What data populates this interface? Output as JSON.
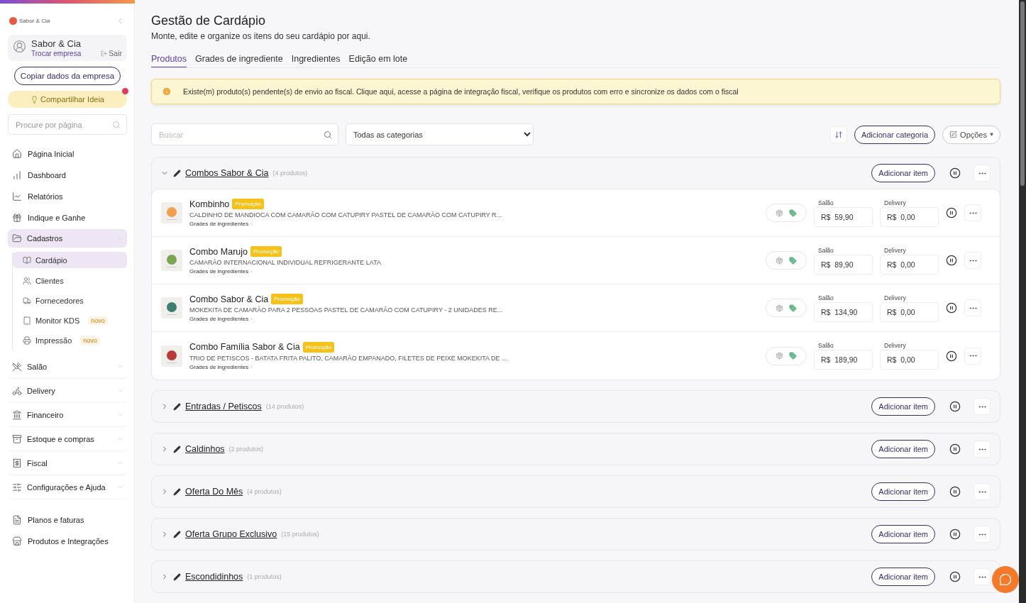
{
  "sidebar": {
    "logo_text": "Sabor & Cia",
    "company": {
      "name": "Sabor & Cia",
      "switch_label": "Trocar empresa",
      "logout_label": "Sair"
    },
    "copy_button": "Copiar dados da empresa",
    "idea_button": {
      "label": "Compartilhar Ideia",
      "notification": true
    },
    "search": {
      "placeholder": "Procure por página"
    },
    "nav": [
      {
        "kind": "link",
        "label": "Página Inicial"
      },
      {
        "kind": "link",
        "label": "Dashboard"
      },
      {
        "kind": "link",
        "label": "Relatórios"
      },
      {
        "kind": "link",
        "label": "Indique e Ganhe"
      },
      {
        "kind": "group",
        "label": "Cadastros",
        "expanded": true,
        "selected": true,
        "children": [
          {
            "label": "Cardápio",
            "selected": true
          },
          {
            "label": "Clientes",
            "selected": false
          },
          {
            "label": "Fornecedores",
            "selected": false
          },
          {
            "label": "Monitor KDS",
            "selected": false,
            "badge": "novo"
          },
          {
            "label": "Impressão",
            "selected": false,
            "badge": "novo"
          }
        ]
      },
      {
        "kind": "group",
        "label": "Salão",
        "expanded": false,
        "selected": false
      },
      {
        "kind": "group",
        "label": "Delivery",
        "expanded": false,
        "selected": false
      },
      {
        "kind": "group",
        "label": "Financeiro",
        "expanded": false,
        "selected": false
      },
      {
        "kind": "group",
        "label": "Estoque e compras",
        "expanded": false,
        "selected": false
      },
      {
        "kind": "group",
        "label": "Fiscal",
        "expanded": false,
        "selected": false
      },
      {
        "kind": "group",
        "label": "Configurações e Ajuda",
        "expanded": false,
        "selected": false
      }
    ],
    "footer_links": [
      "Planos e faturas",
      "Produtos e Integrações"
    ]
  },
  "page": {
    "title": "Gestão de Cardápio",
    "subtitle": "Monte, edite e organize os itens do seu cardápio por aqui."
  },
  "tabs": [
    {
      "label": "Produtos",
      "selected": true
    },
    {
      "label": "Grades de ingrediente",
      "selected": false
    },
    {
      "label": "Ingredientes",
      "selected": false
    },
    {
      "label": "Edição em lote",
      "selected": false
    }
  ],
  "alert": "Existe(m) produto(s) pendente(s) de envio ao fiscal. Clique aqui, acesse a página de integração fiscal, verifique os produtos com erro e sincronize os dados com o fiscal",
  "toolbar": {
    "search_placeholder": "Buscar",
    "category_filter": "Todas as categorias",
    "add_category": "Adicionar categoria",
    "options": "Opções"
  },
  "categories": [
    {
      "name": "Combos Sabor & Cia",
      "count": "(4 produtos)",
      "expanded": true,
      "add_label": "Adicionar item",
      "products": [
        {
          "name": "Kombinho",
          "badge": "Promoção",
          "description": "CALDINHO DE MANDIOCA COM CAMARÃO COM CATUPIRY PASTEL DE CAMARÃO COM CATUPIRY R...",
          "grades_link": "Grades de ingredientes",
          "color": "#f0a050",
          "salao_label": "Salão",
          "salao": "R$  59,90",
          "delivery_label": "Delivery",
          "delivery": "R$  0,00"
        },
        {
          "name": "Combo Marujo",
          "badge": "Promoção",
          "description": "CAMARÃO INTERNACIONAL INDIVIDUAL REFRIGERANTE LATA",
          "grades_link": "Grades de ingredientes",
          "color": "#7aa555",
          "salao_label": "Salão",
          "salao": "R$  89,90",
          "delivery_label": "Delivery",
          "delivery": "R$  0,00"
        },
        {
          "name": "Combo Sabor & Cia",
          "badge": "Promoção",
          "description": "MOKEKITA DE CAMARÃO PARA 2 PESSOAS PASTEL DE CAMARÃO COM CATUPIRY - 2 UNIDADES RE...",
          "grades_link": "Grades de ingredientes",
          "color": "#3f7f72",
          "salao_label": "Salão",
          "salao": "R$  134,90",
          "delivery_label": "Delivery",
          "delivery": "R$  0,00"
        },
        {
          "name": "Combo Família Sabor & Cia",
          "badge": "Promoção",
          "description": "TRIO DE PETISCOS - BATATA FRITA PALITO, CAMARÃO EMPANADO, FILETES DE PEIXE MOKEKITA DE ...",
          "grades_link": "Grades de ingredientes",
          "color": "#b83a3a",
          "salao_label": "Salão",
          "salao": "R$  189,90",
          "delivery_label": "Delivery",
          "delivery": "R$  0,00"
        }
      ]
    },
    {
      "name": "Entradas / Petiscos",
      "count": "(14 produtos)",
      "expanded": false,
      "add_label": "Adicionar item"
    },
    {
      "name": "Caldinhos",
      "count": "(2 produtos)",
      "expanded": false,
      "add_label": "Adicionar item"
    },
    {
      "name": "Oferta Do Mês",
      "count": "(4 produtos)",
      "expanded": false,
      "add_label": "Adicionar item"
    },
    {
      "name": "Oferta Grupo Exclusivo",
      "count": "(15 produtos)",
      "expanded": false,
      "add_label": "Adicionar item"
    },
    {
      "name": "Escondidinhos",
      "count": "(1 produtos)",
      "expanded": false,
      "add_label": "Adicionar item"
    }
  ]
}
